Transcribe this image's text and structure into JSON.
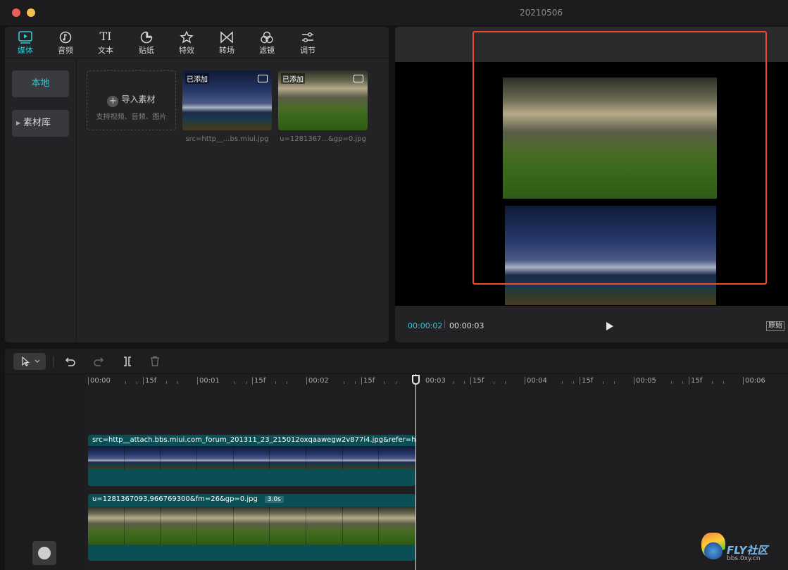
{
  "window": {
    "title": "20210506"
  },
  "toolbar": {
    "tabs": [
      {
        "label": "媒体",
        "icon": "play-box-icon"
      },
      {
        "label": "音频",
        "icon": "music-note-icon"
      },
      {
        "label": "文本",
        "icon": "text-icon"
      },
      {
        "label": "贴纸",
        "icon": "sticker-icon"
      },
      {
        "label": "特效",
        "icon": "star-effect-icon"
      },
      {
        "label": "转场",
        "icon": "transition-icon"
      },
      {
        "label": "滤镜",
        "icon": "filter-icon"
      },
      {
        "label": "调节",
        "icon": "adjust-sliders-icon"
      }
    ],
    "text_glyph": "TI"
  },
  "sidebar": {
    "items": [
      {
        "label": "本地"
      },
      {
        "label": "素材库"
      }
    ]
  },
  "media": {
    "import_label": "导入素材",
    "import_hint": "支持视频、音频、图片",
    "items": [
      {
        "badge": "已添加",
        "caption": "src=http__...bs.miui.jpg"
      },
      {
        "badge": "已添加",
        "caption": "u=1281367...&gp=0.jpg"
      }
    ]
  },
  "preview": {
    "current_time": "00:00:02",
    "total_time": "00:00:03",
    "original_label": "原始",
    "highlight_color": "#f04a2a"
  },
  "timeline": {
    "ruler": [
      "00:00",
      "15f",
      "00:01",
      "15f",
      "00:02",
      "15f",
      "00:03",
      "15f",
      "00:04",
      "15f",
      "00:05",
      "15f",
      "00:06"
    ],
    "clips": [
      {
        "name": "src=http__attach.bbs.miui.com_forum_201311_23_215012oxqaawegw2v877i4.jpg&refer=http__a",
        "duration": ""
      },
      {
        "name": "u=1281367093,966769300&fm=26&gp=0.jpg",
        "duration": "3.0s"
      }
    ]
  },
  "watermark": {
    "title": "FLY社区",
    "url": "bbs.0xy.cn"
  },
  "colors": {
    "accent": "#38c8d6",
    "clip": "#0a4f55"
  }
}
